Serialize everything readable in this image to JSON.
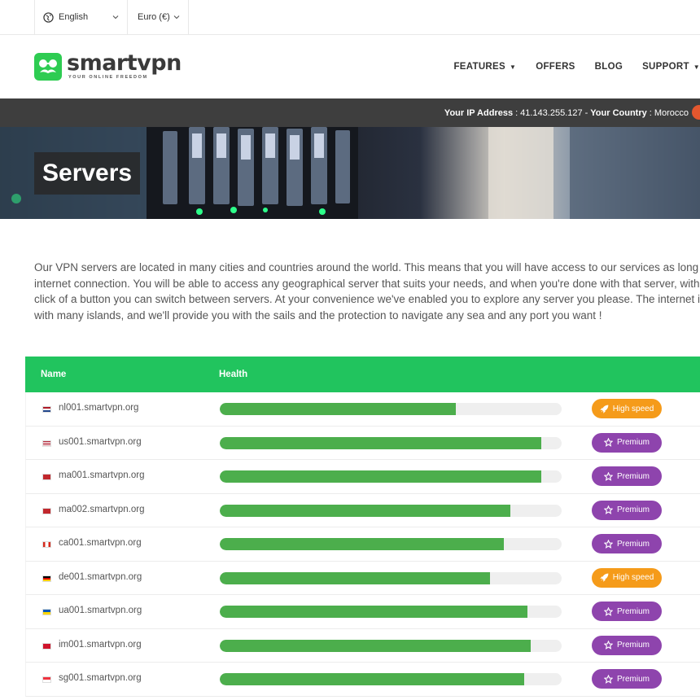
{
  "topbar": {
    "language": "English",
    "currency": "Euro (€)"
  },
  "logo": {
    "word": "smartvpn",
    "tagline": "YOUR ONLINE FREEDOM"
  },
  "nav": [
    {
      "label": "FEATURES",
      "dropdown": true
    },
    {
      "label": "OFFERS",
      "dropdown": false
    },
    {
      "label": "BLOG",
      "dropdown": false
    },
    {
      "label": "SUPPORT",
      "dropdown": true
    }
  ],
  "ipbar": {
    "ip_label": "Your IP Address",
    "ip_value": "41.143.255.127",
    "country_label": "Your Country",
    "country_value": "Morocco"
  },
  "hero": {
    "title": "Servers"
  },
  "intro": [
    "Our VPN servers are located in many cities and countries around the world. This means that you will have access to our services as long as y",
    "internet connection. You will be able to access any geographical server that suits your needs, and when you're done with that server, with th",
    "click of a button you can switch between servers. At your convenience we've enabled you to explore any server you please. The internet is a",
    "with many islands, and we'll provide you with the sails and the protection to navigate any sea and any port you want !"
  ],
  "table": {
    "headers": {
      "name": "Name",
      "health": "Health"
    },
    "rows": [
      {
        "host": "nl001.smartvpn.org",
        "flag": "nl",
        "health": 0.69,
        "badge": "High speed",
        "badge_type": "orange"
      },
      {
        "host": "us001.smartvpn.org",
        "flag": "us",
        "health": 0.94,
        "badge": "Premium",
        "badge_type": "purple"
      },
      {
        "host": "ma001.smartvpn.org",
        "flag": "ma",
        "health": 0.94,
        "badge": "Premium",
        "badge_type": "purple"
      },
      {
        "host": "ma002.smartvpn.org",
        "flag": "ma",
        "health": 0.85,
        "badge": "Premium",
        "badge_type": "purple"
      },
      {
        "host": "ca001.smartvpn.org",
        "flag": "ca",
        "health": 0.83,
        "badge": "Premium",
        "badge_type": "purple"
      },
      {
        "host": "de001.smartvpn.org",
        "flag": "de",
        "health": 0.79,
        "badge": "High speed",
        "badge_type": "orange"
      },
      {
        "host": "ua001.smartvpn.org",
        "flag": "ua",
        "health": 0.9,
        "badge": "Premium",
        "badge_type": "purple"
      },
      {
        "host": "im001.smartvpn.org",
        "flag": "im",
        "health": 0.91,
        "badge": "Premium",
        "badge_type": "purple"
      },
      {
        "host": "sg001.smartvpn.org",
        "flag": "sg",
        "health": 0.89,
        "badge": "Premium",
        "badge_type": "purple"
      }
    ]
  },
  "colors": {
    "brand_green": "#2ecc52",
    "table_header": "#21c45e",
    "health_bar": "#4cae4c",
    "badge_high_speed": "#f59b1a",
    "badge_premium": "#8e44ad",
    "ip_bar": "#3e3e3e"
  }
}
